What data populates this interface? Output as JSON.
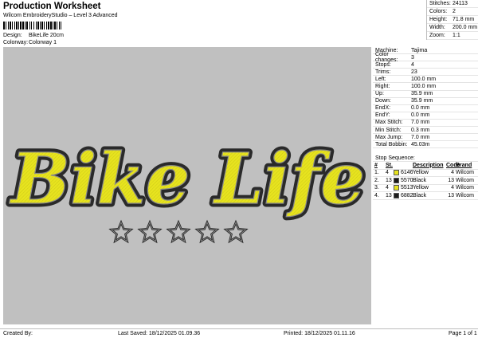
{
  "header": {
    "title": "Production Worksheet",
    "subtitle": "Wilcom EmbroideryStudio – Level 3 Advanced",
    "design_label": "Design:",
    "design_value": "BikeLife 20cm",
    "colorway_label": "Colorway:",
    "colorway_value": "Colorway 1"
  },
  "stats": [
    {
      "label": "Stitches:",
      "value": "24113"
    },
    {
      "label": "Colors:",
      "value": "2"
    },
    {
      "label": "Height:",
      "value": "71.8 mm"
    },
    {
      "label": "Width:",
      "value": "200.0 mm"
    },
    {
      "label": "Zoom:",
      "value": "1:1"
    }
  ],
  "design": {
    "text": "Bike Life",
    "star_count": 5,
    "colors": {
      "background": "#c0c0c0",
      "fill": "#e7e31f",
      "outline": "#2a2a2a"
    }
  },
  "machine_info": [
    {
      "label": "Machine:",
      "value": "Tajima"
    },
    {
      "label": "Color changes:",
      "value": "3"
    },
    {
      "label": "Stops:",
      "value": "4"
    },
    {
      "label": "Trims:",
      "value": "23"
    },
    {
      "label": "Left:",
      "value": "100.0 mm"
    },
    {
      "label": "Right:",
      "value": "100.0 mm"
    },
    {
      "label": "Up:",
      "value": "35.9 mm"
    },
    {
      "label": "Down:",
      "value": "35.9 mm"
    },
    {
      "label": "EndX:",
      "value": "0.0 mm"
    },
    {
      "label": "EndY:",
      "value": "0.0 mm"
    },
    {
      "label": "Max Stitch:",
      "value": "7.0 mm"
    },
    {
      "label": "Min Stitch:",
      "value": "0.3 mm"
    },
    {
      "label": "Max Jump:",
      "value": "7.0 mm"
    },
    {
      "label": "Total Bobbin:",
      "value": "45.03m"
    }
  ],
  "stop_sequence": {
    "title": "Stop Sequence:",
    "headers": {
      "n": "#",
      "st": "St.",
      "description": "Description",
      "code": "Code",
      "brand": "Brand"
    },
    "rows": [
      {
        "index": "1.",
        "n": "4",
        "code": "6146",
        "description": "Yellow",
        "code2": "4",
        "brand": "Wilcom",
        "color": "#e6e21e"
      },
      {
        "index": "2.",
        "n": "13",
        "code": "5570",
        "description": "Black",
        "code2": "13",
        "brand": "Wilcom",
        "color": "#1a1a1a"
      },
      {
        "index": "3.",
        "n": "4",
        "code": "5513",
        "description": "Yellow",
        "code2": "4",
        "brand": "Wilcom",
        "color": "#e6e21e"
      },
      {
        "index": "4.",
        "n": "13",
        "code": "6882",
        "description": "Black",
        "code2": "13",
        "brand": "Wilcom",
        "color": "#1a1a1a"
      }
    ]
  },
  "footer": {
    "created": "Created By:",
    "saved": "Last Saved: 18/12/2025 01.09.36",
    "printed": "Printed: 18/12/2025 01.11.16",
    "page": "Page 1 of 1"
  }
}
